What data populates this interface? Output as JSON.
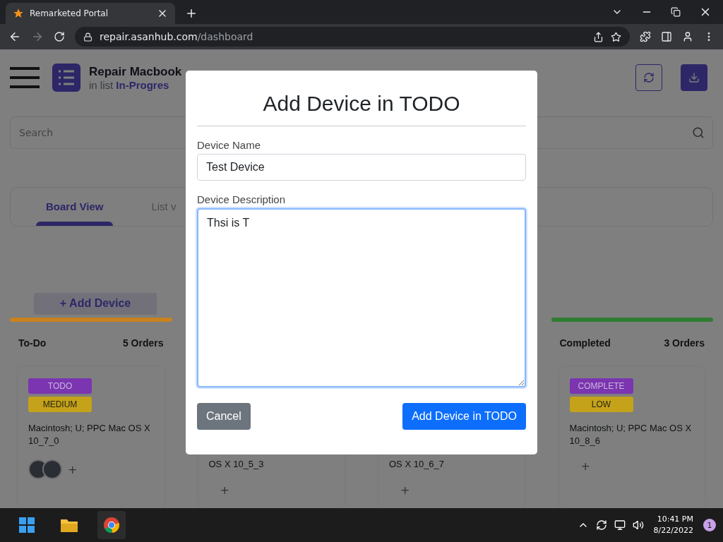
{
  "browser": {
    "tab_title": "Remarketed Portal",
    "url_host": "repair.asanhub.com",
    "url_path": "/dashboard"
  },
  "header": {
    "title": "Repair Macbook",
    "list_prefix": "in list",
    "list_name": "In-Progres"
  },
  "search": {
    "placeholder": "Search"
  },
  "tabs": [
    {
      "label": "Board View",
      "selected": true
    },
    {
      "label": "List v",
      "selected": false
    }
  ],
  "add_button": {
    "icon": "+",
    "label": "Add Device"
  },
  "columns": [
    {
      "title": "To-Do",
      "count": "5 Orders",
      "color": "#c8821e",
      "card": {
        "tags": [
          {
            "label": "TODO",
            "color": "#7b35b0"
          },
          {
            "label": "MEDIUM",
            "color": "#c4a21a"
          }
        ],
        "text": "Macintosh; U; PPC Mac OS X 10_7_0",
        "members": [
          {
            "kind": "avatar"
          },
          {
            "kind": "avatar"
          }
        ],
        "plus": "+"
      }
    },
    {
      "card": {
        "text": "OS X 10_5_3",
        "plus": "+"
      }
    },
    {
      "card": {
        "text": "OS X 10_6_7",
        "plus": "+"
      }
    },
    {
      "title": "Completed",
      "count": "3 Orders",
      "color": "#2e7d32",
      "card": {
        "tags": [
          {
            "label": "COMPLETE",
            "color": "#7b35b0"
          },
          {
            "label": "LOW",
            "color": "#c4a21a"
          }
        ],
        "text": "Macintosh; U; PPC Mac OS X 10_8_6",
        "plus": "+"
      }
    }
  ],
  "modal": {
    "title": "Add Device in TODO",
    "name_label": "Device Name",
    "name_value": "Test Device",
    "desc_label": "Device Description",
    "desc_value": "Thsi is T",
    "cancel": "Cancel",
    "submit": "Add Device in TODO"
  },
  "taskbar": {
    "time": "10:41 PM",
    "date": "8/22/2022",
    "notifications": "1"
  }
}
